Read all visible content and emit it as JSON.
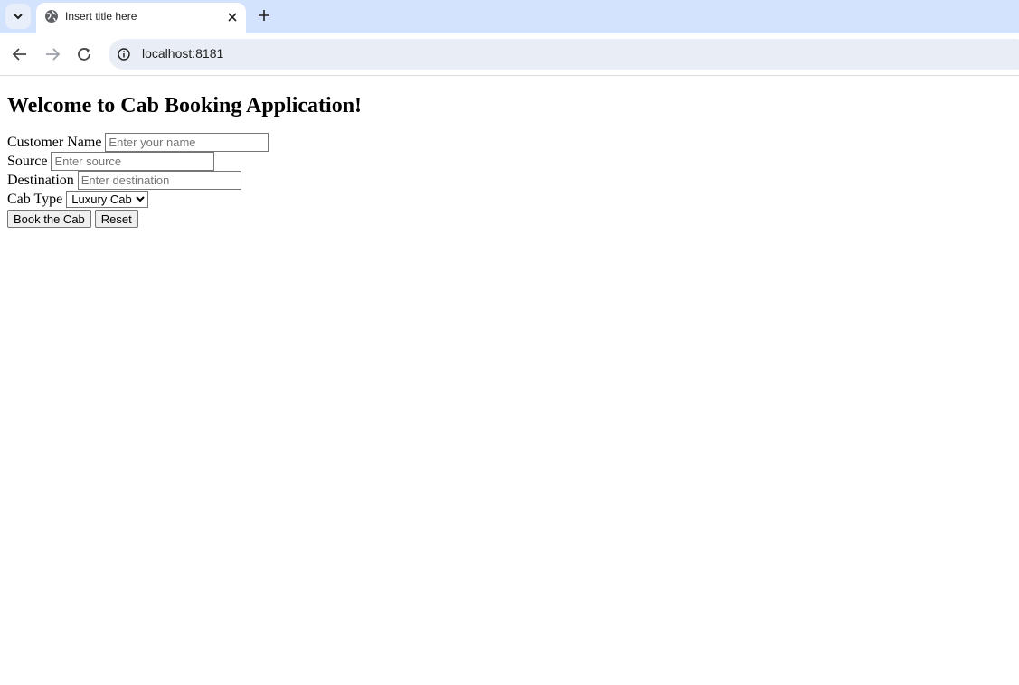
{
  "browser": {
    "tab_title": "Insert title here",
    "url": "localhost:8181"
  },
  "page": {
    "heading": "Welcome to Cab Booking Application!",
    "form": {
      "customer_name_label": "Customer Name",
      "customer_name_placeholder": "Enter your name",
      "source_label": "Source",
      "source_placeholder": "Enter source",
      "destination_label": "Destination",
      "destination_placeholder": "Enter destination",
      "cab_type_label": "Cab Type",
      "cab_type_selected": "Luxury Cab",
      "book_button": "Book the Cab",
      "reset_button": "Reset"
    }
  }
}
